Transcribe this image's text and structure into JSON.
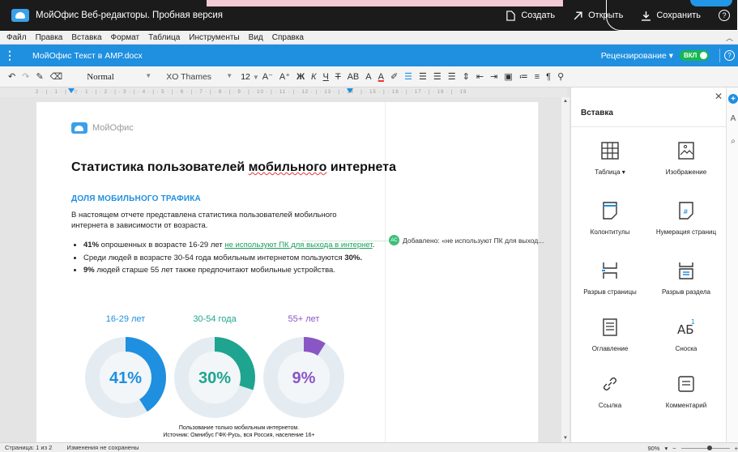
{
  "titlebar": {
    "title": "МойОфис Веб-редакторы. Пробная версия",
    "create_label": "Создать",
    "open_label": "Открыть",
    "save_label": "Сохранить"
  },
  "menu": [
    "Файл",
    "Правка",
    "Вставка",
    "Формат",
    "Таблица",
    "Инструменты",
    "Вид",
    "Справка"
  ],
  "docbar": {
    "doc_name": "МойОфис Текст в AMP.docx",
    "review_label": "Рецензирование",
    "toggle_label": "ВКЛ"
  },
  "toolbar": {
    "style": "Normal",
    "font": "XO Thames",
    "size": "12",
    "decrease_font": "A⁻",
    "increase_font": "A⁺",
    "bold": "Ж",
    "italic": "К",
    "underline": "Ч",
    "strike": "Т",
    "caps": "AB",
    "subscript": "A",
    "font_color": "A",
    "paragraph": "¶"
  },
  "ruler": "2 · | · 1 · | · ▽ · 1 · | · 2 · | · 3 · | · 4 · | · 5 · | · 6 · | · 7 · | · 8 · | · 9 · | · 10 · | · 11 · | · 12 · | · 13 · | · 14 · | · 15 · | · 16 · | · 17 · | · 18 · | · 19",
  "document": {
    "logo_text": "МойОфис",
    "title_part1": "Статистика пользователей ",
    "title_part2": "мобильного",
    "title_part3": " интернета",
    "section_title": "ДОЛЯ МОБИЛЬНОГО ТРАФИКА",
    "intro": "В настоящем отчете представлена статистика пользователей мобильного интернета в зависимости от возраста.",
    "bullet1_bold": "41%",
    "bullet1_text": " опрошенных в возрасте 16-29 лет ",
    "bullet1_green": "не используют ПК для выхода в интернет",
    "bullet1_end": ".",
    "bullet2_text": "Среди людей в возрасте 30-54 года мобильным интернетом пользуются ",
    "bullet2_bold": "30%.",
    "bullet3_bold": "9%",
    "bullet3_text": " людей старше 55 лет также предпочитают мобильные устройства.",
    "caption_line1": "Пользование только мобильным интернетом.",
    "caption_line2": "Источник: Омнибус ГФК-Русь, вся Россия, население 16+"
  },
  "charts": [
    {
      "label": "16-29 лет",
      "percent": 41,
      "value_text": "41%",
      "color": "#1f8fe0"
    },
    {
      "label": "30-54 года",
      "percent": 30,
      "value_text": "30%",
      "color": "#1fa58f"
    },
    {
      "label": "55+ лет",
      "percent": 9,
      "value_text": "9%",
      "color": "#8a56c6"
    }
  ],
  "comment": {
    "avatar": "АС",
    "text": "Добавлено: «не используют ПК для выход..."
  },
  "panel": {
    "title": "Вставка",
    "items": [
      {
        "label": "Таблица ▾",
        "icon": "table-icon"
      },
      {
        "label": "Изображение",
        "icon": "image-icon"
      },
      {
        "label": "Колонтитулы",
        "icon": "header-footer-icon"
      },
      {
        "label": "Нумерация страниц",
        "icon": "page-number-icon"
      },
      {
        "label": "Разрыв страницы",
        "icon": "page-break-icon"
      },
      {
        "label": "Разрыв раздела",
        "icon": "section-break-icon"
      },
      {
        "label": "Оглавление",
        "icon": "toc-icon"
      },
      {
        "label": "Сноска",
        "icon": "footnote-icon"
      },
      {
        "label": "Ссылка",
        "icon": "link-icon"
      },
      {
        "label": "Комментарий",
        "icon": "comment-icon"
      }
    ]
  },
  "status": {
    "page": "Страница: 1 из 2",
    "changes": "Изменения не сохранены",
    "zoom": "90%"
  },
  "colors": {
    "accent": "#1f8fe0",
    "green": "#19a05b",
    "toggle": "#16b84f"
  }
}
